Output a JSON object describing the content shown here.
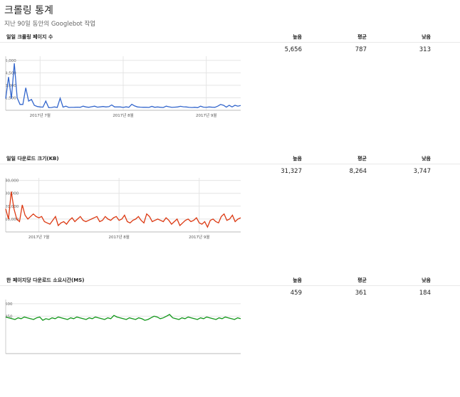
{
  "page": {
    "title": "크롤링 통계",
    "subtitle": "지난 90일 동안의 Googlebot 작업"
  },
  "stat_labels": {
    "high": "높음",
    "avg": "평균",
    "low": "낮음"
  },
  "sections": [
    {
      "title": "일일 크롤링 페이지 수",
      "high": "5,656",
      "avg": "787",
      "low": "313",
      "color": "#3366cc"
    },
    {
      "title": "일일 다운로드 크기(KB)",
      "high": "31,327",
      "avg": "8,264",
      "low": "3,747",
      "color": "#dc3912"
    },
    {
      "title": "한 페이지당 다운로드 소요시간(MS)",
      "high": "459",
      "avg": "361",
      "low": "184",
      "color": "#109618"
    }
  ],
  "chart_data": [
    {
      "type": "line",
      "yticks": [
        1500,
        3000,
        4500,
        6000
      ],
      "yticklabels": [
        "1,500",
        "3,000",
        "4,500",
        "6,000"
      ],
      "ylim": [
        0,
        6500
      ],
      "xticklabels": [
        "2017년 7월",
        "2017년 8월",
        "2017년 9월"
      ],
      "xtick_index": [
        12,
        41,
        70
      ],
      "series": [
        {
          "values": [
            1400,
            4000,
            1400,
            5656,
            1500,
            700,
            700,
            2700,
            1100,
            1300,
            600,
            450,
            400,
            380,
            1100,
            320,
            330,
            400,
            340,
            1450,
            380,
            500,
            340,
            350,
            360,
            380,
            360,
            500,
            400,
            360,
            430,
            500,
            380,
            410,
            450,
            400,
            440,
            640,
            400,
            400,
            400,
            340,
            410,
            360,
            720,
            520,
            400,
            380,
            360,
            360,
            340,
            470,
            360,
            400,
            360,
            330,
            500,
            420,
            350,
            380,
            400,
            480,
            420,
            400,
            350,
            330,
            360,
            313,
            500,
            380,
            350,
            400,
            370,
            360,
            500,
            700,
            600,
            380,
            600,
            400,
            600,
            500,
            580
          ]
        }
      ]
    },
    {
      "type": "line",
      "yticks": [
        10000,
        20000,
        30000,
        40000
      ],
      "yticklabels": [
        "10,000",
        "20,000",
        "30,000",
        "40,000"
      ],
      "ylim": [
        0,
        42000
      ],
      "xticklabels": [
        "2017년 7월",
        "2017년 8월",
        "2017년 9월"
      ],
      "xtick_index": [
        12,
        41,
        70
      ],
      "series": [
        {
          "values": [
            18000,
            10000,
            31327,
            18000,
            10000,
            8000,
            21000,
            13000,
            10000,
            12000,
            14000,
            12000,
            11000,
            12000,
            8000,
            7000,
            6000,
            9000,
            12000,
            5000,
            7000,
            8000,
            6000,
            9000,
            11000,
            8000,
            10000,
            12000,
            9000,
            8000,
            9000,
            10000,
            11000,
            12000,
            8000,
            9000,
            12000,
            10000,
            9000,
            11000,
            12000,
            9000,
            10000,
            13000,
            8000,
            7000,
            9000,
            10000,
            12000,
            9000,
            7000,
            14000,
            12000,
            8000,
            9000,
            10000,
            9000,
            8000,
            11000,
            9000,
            6000,
            8000,
            10000,
            5000,
            7000,
            9000,
            10000,
            8000,
            9000,
            11000,
            7000,
            6000,
            8000,
            3747,
            9000,
            10000,
            8000,
            7000,
            12000,
            14000,
            9000,
            10000,
            13000,
            8000,
            10000,
            11000
          ]
        }
      ]
    },
    {
      "type": "line",
      "yticks": [
        450,
        600
      ],
      "yticklabels": [
        "450",
        "600"
      ],
      "ylim": [
        0,
        650
      ],
      "series": [
        {
          "values": [
            440,
            430,
            420,
            410,
            430,
            420,
            440,
            430,
            420,
            410,
            430,
            440,
            400,
            420,
            410,
            430,
            420,
            440,
            430,
            420,
            410,
            430,
            420,
            440,
            430,
            420,
            410,
            430,
            420,
            440,
            430,
            420,
            410,
            430,
            420,
            459,
            440,
            430,
            420,
            410,
            430,
            420,
            410,
            430,
            420,
            400,
            410,
            430,
            450,
            440,
            420,
            430,
            450,
            470,
            430,
            420,
            410,
            430,
            420,
            440,
            430,
            420,
            410,
            430,
            420,
            440,
            430,
            420,
            410,
            430,
            420,
            440,
            430,
            420,
            410,
            430,
            420
          ]
        }
      ]
    }
  ]
}
